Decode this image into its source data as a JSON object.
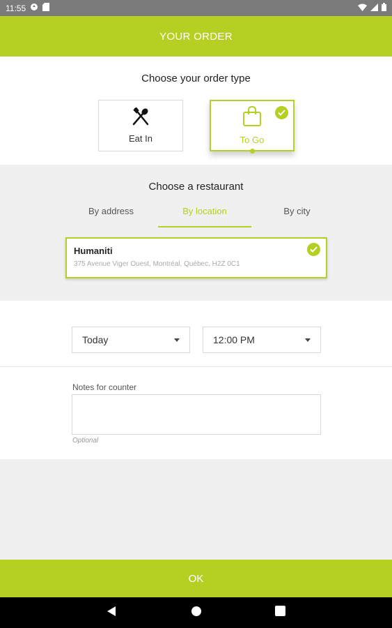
{
  "status_bar": {
    "time": "11:55"
  },
  "header": {
    "title": "YOUR ORDER"
  },
  "order_type": {
    "title": "Choose your order type",
    "options": [
      {
        "label": "Eat In",
        "icon": "utensils-icon",
        "selected": false
      },
      {
        "label": "To Go",
        "icon": "shopping-bag-icon",
        "selected": true
      }
    ]
  },
  "restaurant": {
    "title": "Choose a restaurant",
    "tabs": [
      {
        "label": "By address",
        "active": false
      },
      {
        "label": "By location",
        "active": true
      },
      {
        "label": "By city",
        "active": false
      }
    ],
    "selected": {
      "name": "Humaniti",
      "address": "375 Avenue Viger Ouest, Montréal, Québec, H2Z 0C1"
    }
  },
  "schedule": {
    "day": "Today",
    "time": "12:00 PM"
  },
  "notes": {
    "label": "Notes for counter",
    "value": "",
    "hint": "Optional"
  },
  "ok_button": {
    "label": "OK"
  },
  "colors": {
    "accent": "#b5cf22",
    "status_bar": "#7a7a7a",
    "nav_bar": "#000000"
  }
}
